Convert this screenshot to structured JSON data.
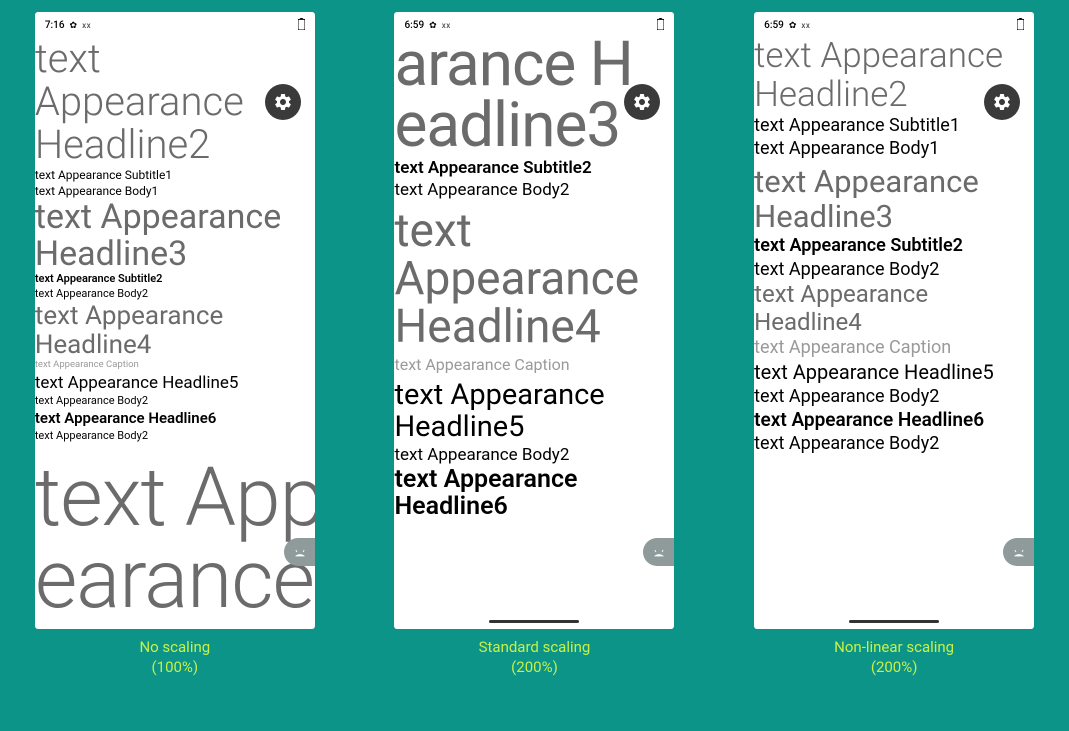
{
  "status": {
    "time1": "7:16",
    "time2": "6:59",
    "time3": "6:59",
    "xx": "xx"
  },
  "txt": {
    "h2": "text Appearance Headline2",
    "sub1": "text Appearance Subtitle1",
    "body1": "text Appearance Body1",
    "h3": "text Appearance Headline3",
    "sub2": "text Appearance Subtitle2",
    "body2": "text Appearance Body2",
    "h4": "text Appearance Headline4",
    "cap": "text Appearance Caption",
    "h5": "text Appearance Headline5",
    "h6": "text Appearance Headline6",
    "huge1": "text App",
    "huge2": "earance",
    "p2h3a": "arance H",
    "p2h3b": "eadline3"
  },
  "captions": {
    "c1a": "No scaling",
    "c1b": "(100%)",
    "c2a": "Standard scaling",
    "c2b": "(200%)",
    "c3a": "Non-linear scaling",
    "c3b": "(200%)"
  }
}
